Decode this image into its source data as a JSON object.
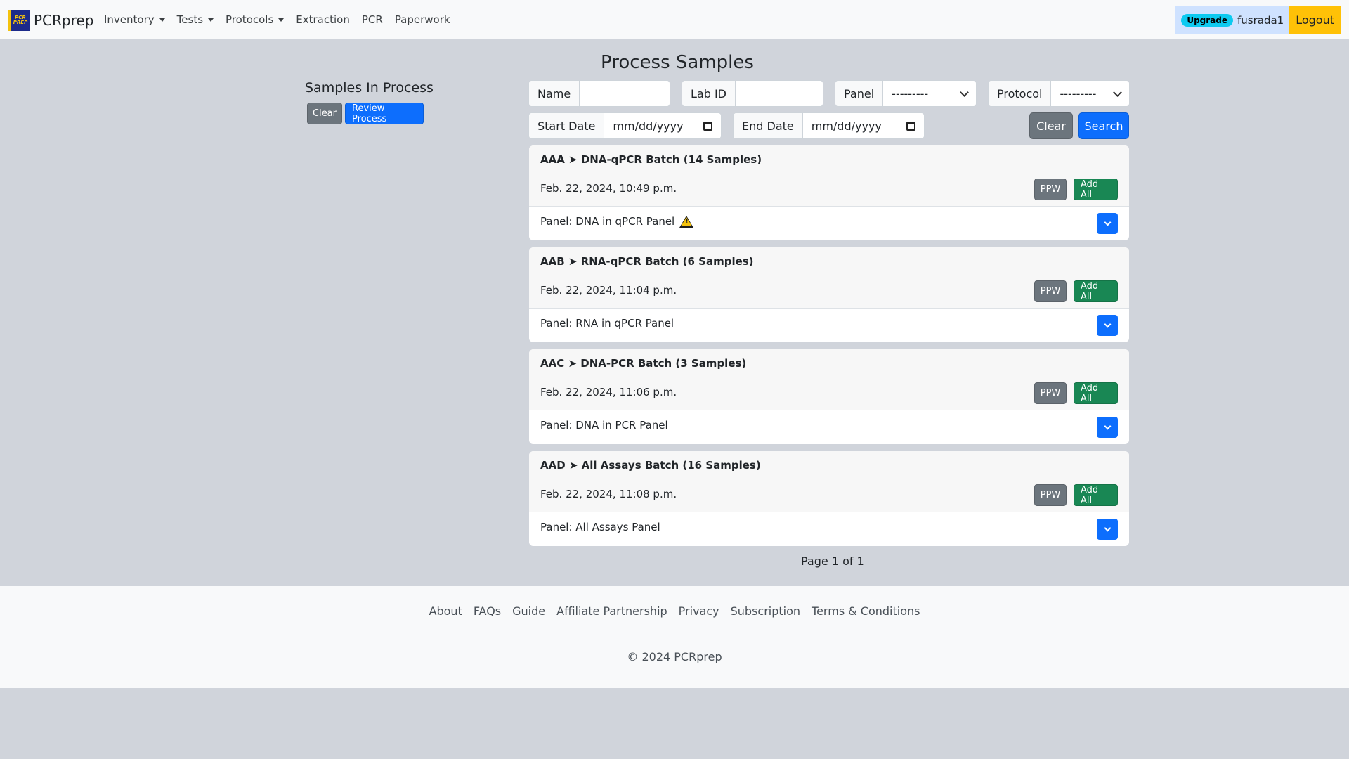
{
  "nav": {
    "brand": "PCRprep",
    "logo_text": "PCR PREP",
    "links": [
      {
        "label": "Inventory"
      },
      {
        "label": "Tests"
      },
      {
        "label": "Protocols"
      },
      {
        "label": "Extraction"
      },
      {
        "label": "PCR"
      },
      {
        "label": "Paperwork"
      }
    ],
    "upgrade_label": "Upgrade",
    "username": "fusrada1",
    "logout_label": "Logout"
  },
  "page_title": "Process Samples",
  "sidebar": {
    "title": "Samples In Process",
    "clear_label": "Clear",
    "review_label": "Review Process"
  },
  "filters": {
    "name_label": "Name",
    "name_value": "",
    "labid_label": "Lab ID",
    "labid_value": "",
    "panel_label": "Panel",
    "panel_value": "---------",
    "protocol_label": "Protocol",
    "protocol_value": "---------",
    "start_label": "Start Date",
    "start_value": "mm/dd/yyyy",
    "end_label": "End Date",
    "end_value": "mm/dd/yyyy",
    "clear_label": "Clear",
    "search_label": "Search"
  },
  "batches": [
    {
      "title": "AAA ➤ DNA-qPCR Batch (14 Samples)",
      "date": "Feb. 22, 2024, 10:49 p.m.",
      "panel": "Panel: DNA in qPCR Panel",
      "warning": true,
      "ppw_label": "PPW",
      "add_all_label": "Add All"
    },
    {
      "title": "AAB ➤ RNA-qPCR Batch (6 Samples)",
      "date": "Feb. 22, 2024, 11:04 p.m.",
      "panel": "Panel: RNA in qPCR Panel",
      "warning": false,
      "ppw_label": "PPW",
      "add_all_label": "Add All"
    },
    {
      "title": "AAC ➤ DNA-PCR Batch (3 Samples)",
      "date": "Feb. 22, 2024, 11:06 p.m.",
      "panel": "Panel: DNA in PCR Panel",
      "warning": false,
      "ppw_label": "PPW",
      "add_all_label": "Add All"
    },
    {
      "title": "AAD ➤ All Assays Batch (16 Samples)",
      "date": "Feb. 22, 2024, 11:08 p.m.",
      "panel": "Panel: All Assays Panel",
      "warning": false,
      "ppw_label": "PPW",
      "add_all_label": "Add All"
    }
  ],
  "pagination": "Page 1 of 1",
  "footer": {
    "links": [
      "About",
      "FAQs",
      "Guide",
      "Affiliate Partnership",
      "Privacy",
      "Subscription",
      "Terms & Conditions"
    ],
    "copyright": "© 2024 PCRprep"
  }
}
